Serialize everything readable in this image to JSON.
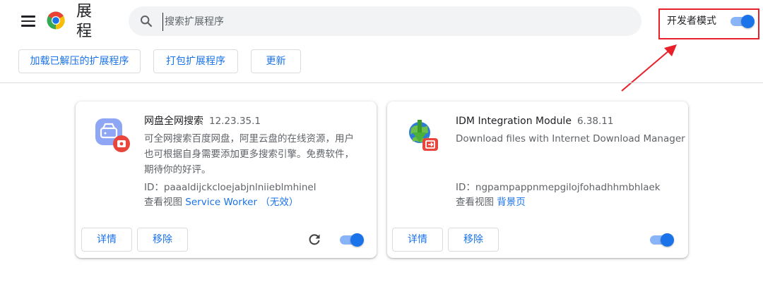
{
  "header": {
    "title": "扩展程序",
    "title_line1": "展",
    "title_line2": "程",
    "search_placeholder": "搜索扩展程序",
    "developer_mode_label": "开发者模式",
    "developer_mode_on": true
  },
  "toolbar": {
    "load_unpacked": "加载已解压的扩展程序",
    "pack_extension": "打包扩展程序",
    "update": "更新"
  },
  "extensions": [
    {
      "name": "网盘全网搜索",
      "version": "12.23.35.1",
      "description_lines": [
        "可全网搜索百度网盘，阿里云盘的在线资源，用户",
        "也可根据自身需要添加更多搜索引擎。免费软件，",
        "期待你的好评。"
      ],
      "id_label": "ID：",
      "id": "paaaldijckcloejabjnlniieblmhinel",
      "inspect_label": "查看视图",
      "view_link": "Service Worker",
      "view_status": "（无效）",
      "details_label": "详情",
      "remove_label": "移除",
      "enabled": true
    },
    {
      "name": "IDM Integration Module",
      "version": "6.38.11",
      "description_lines": [
        "Download files with Internet Download Manager"
      ],
      "id_label": "ID：",
      "id": "ngpampappnmepgilojfohadhhmbhlaek",
      "inspect_label": "查看视图",
      "view_link": "背景页",
      "details_label": "详情",
      "remove_label": "移除",
      "enabled": true
    }
  ],
  "colors": {
    "accent": "#1a73e8",
    "accent_light": "#8ab4f8",
    "highlight_red": "#e8202a",
    "text_secondary": "#5f6368",
    "border": "#dadce0"
  }
}
